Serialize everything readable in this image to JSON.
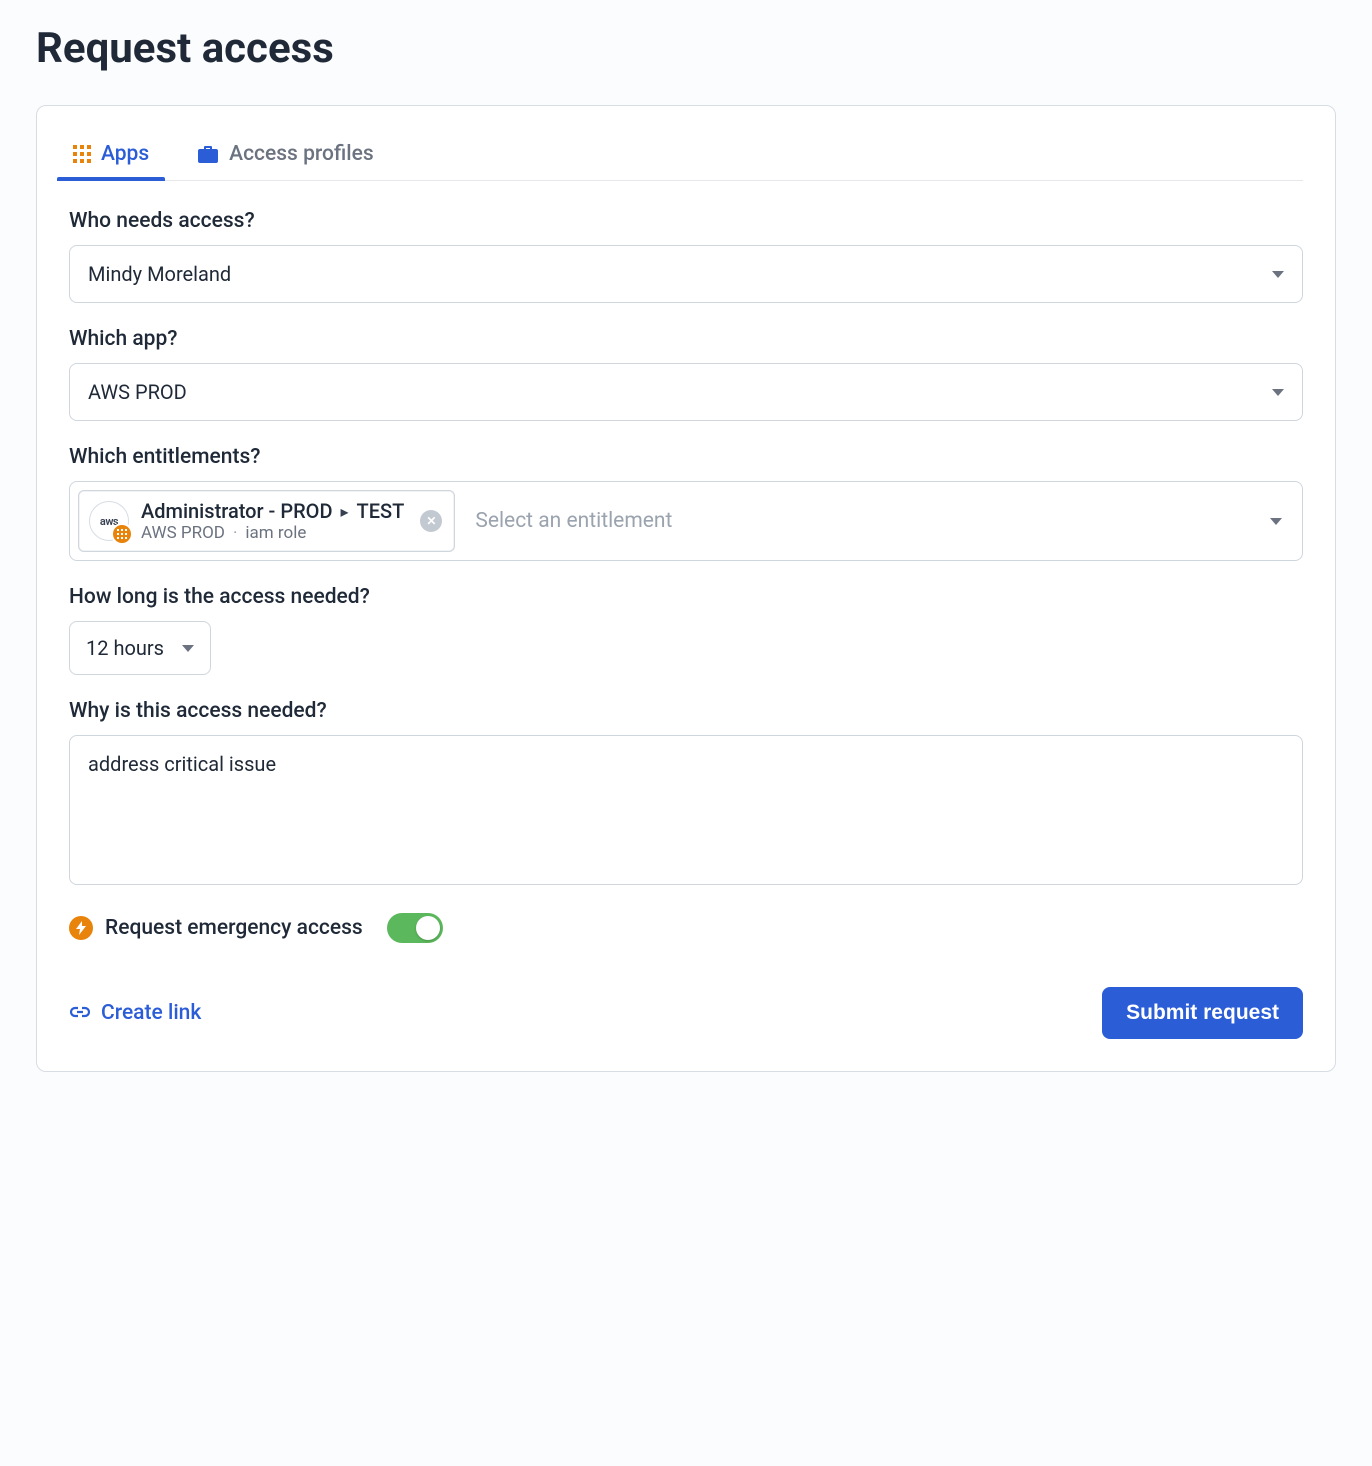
{
  "page": {
    "title": "Request access"
  },
  "tabs": {
    "apps": "Apps",
    "profiles": "Access profiles"
  },
  "labels": {
    "who": "Who needs access?",
    "app": "Which app?",
    "entitlements": "Which entitlements?",
    "duration": "How long is the access needed?",
    "reason": "Why is this access needed?"
  },
  "who": {
    "value": "Mindy Moreland"
  },
  "app": {
    "value": "AWS PROD"
  },
  "entitlements": {
    "placeholder": "Select an entitlement",
    "chip": {
      "icon_text": "aws",
      "title_a": "Administrator - PROD",
      "title_b": "TEST",
      "sub_app": "AWS PROD",
      "sub_type": "iam role"
    }
  },
  "duration": {
    "value": "12 hours"
  },
  "reason": {
    "value": "address critical issue"
  },
  "emergency": {
    "label": "Request emergency access",
    "enabled": true
  },
  "footer": {
    "create_link": "Create link",
    "submit": "Submit request"
  },
  "colors": {
    "accent": "#2b5dd7",
    "orange": "#e8830c",
    "toggle_on": "#5cb85c"
  }
}
